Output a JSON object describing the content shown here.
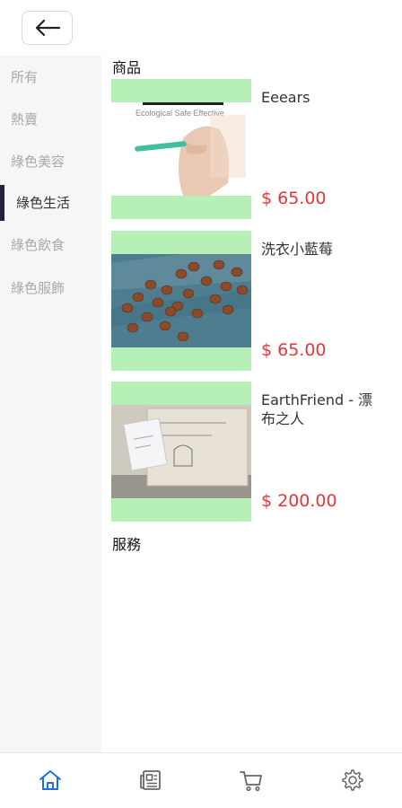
{
  "header": {
    "back_icon": "arrow-left-icon"
  },
  "sidebar": {
    "items": [
      {
        "label": "所有",
        "active": false
      },
      {
        "label": "熱賣",
        "active": false
      },
      {
        "label": "綠色美容",
        "active": false
      },
      {
        "label": "綠色生活",
        "active": true
      },
      {
        "label": "綠色飲食",
        "active": false
      },
      {
        "label": "綠色服飾",
        "active": false
      }
    ]
  },
  "main": {
    "products_heading": "商品",
    "services_heading": "服務",
    "products": [
      {
        "name": "Eeears",
        "price": "$ 65.00",
        "image_caption": "Ecological Safe Effective"
      },
      {
        "name": "洗衣小藍莓",
        "price": "$ 65.00"
      },
      {
        "name": "EarthFriend - 漂布之人",
        "price": "$ 200.00"
      }
    ]
  },
  "bottom_nav": {
    "items": [
      {
        "icon": "home-icon",
        "active": true
      },
      {
        "icon": "news-icon",
        "active": false
      },
      {
        "icon": "cart-icon",
        "active": false
      },
      {
        "icon": "gear-icon",
        "active": false
      }
    ]
  },
  "colors": {
    "accent": "#1e6fe0",
    "price": "#e8353a",
    "thumb_placeholder": "#b6f0b6",
    "sidebar_bg": "#f6f6f7",
    "active_indicator": "#22223a"
  }
}
